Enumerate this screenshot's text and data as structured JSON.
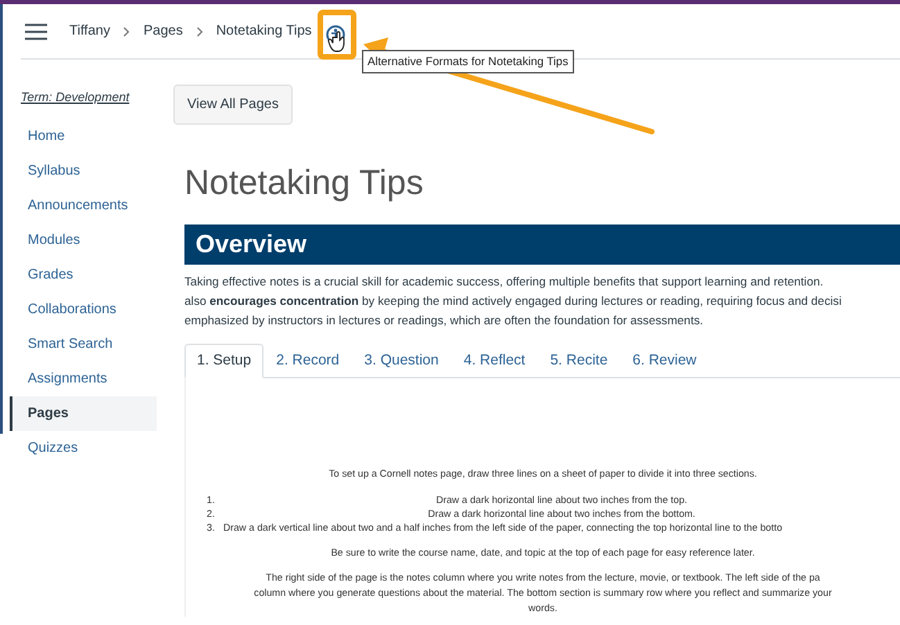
{
  "breadcrumb": [
    {
      "label": "Tiffany"
    },
    {
      "label": "Pages"
    },
    {
      "label": "Notetaking Tips"
    }
  ],
  "tooltip": "Alternative Formats for Notetaking Tips",
  "sidebar": {
    "term": "Term: Development",
    "items": [
      {
        "label": "Home",
        "selected": false
      },
      {
        "label": "Syllabus",
        "selected": false
      },
      {
        "label": "Announcements",
        "selected": false
      },
      {
        "label": "Modules",
        "selected": false
      },
      {
        "label": "Grades",
        "selected": false
      },
      {
        "label": "Collaborations",
        "selected": false
      },
      {
        "label": "Smart Search",
        "selected": false
      },
      {
        "label": "Assignments",
        "selected": false
      },
      {
        "label": "Pages",
        "selected": true
      },
      {
        "label": "Quizzes",
        "selected": false
      }
    ]
  },
  "view_all_button": "View All Pages",
  "title": "Notetaking Tips",
  "overview": {
    "heading": "Overview",
    "paragraph": "Taking effective notes is a crucial skill for academic success, offering multiple benefits that support learning and retention.\nalso **encourages concentration** by keeping the mind actively engaged during lectures or reading, requiring focus and decisi\nemphasized by instructors in lectures or readings, which are often the foundation for assessments."
  },
  "tabs": [
    {
      "label": "1. Setup",
      "selected": true
    },
    {
      "label": "2. Record",
      "selected": false
    },
    {
      "label": "3. Question",
      "selected": false
    },
    {
      "label": "4. Reflect",
      "selected": false
    },
    {
      "label": "5. Recite",
      "selected": false
    },
    {
      "label": "6. Review",
      "selected": false
    }
  ],
  "panel": {
    "intro": "To set up a Cornell notes page, draw three lines on a sheet of paper to divide it into three sections.",
    "steps": [
      {
        "number": "1.",
        "text": "Draw a dark horizontal line about two inches from the top.",
        "centered": true
      },
      {
        "number": "2.",
        "text": "Draw a dark horizontal line about two inches from the bottom.",
        "centered": true
      },
      {
        "number": "3.",
        "text": "Draw a dark vertical line about two and a half inches from the left side of the paper, connecting the top horizontal line to the botto",
        "centered": false
      }
    ],
    "note": "Be sure to write the course name, date, and topic at the top of each page for easy reference later.",
    "description": "The right side of the page is the notes column where you write notes from the lecture, movie, or textbook. The left side of the pa\ncolumn where you generate questions about the material. The bottom section is summary row where you reflect and summarize your\nwords."
  }
}
